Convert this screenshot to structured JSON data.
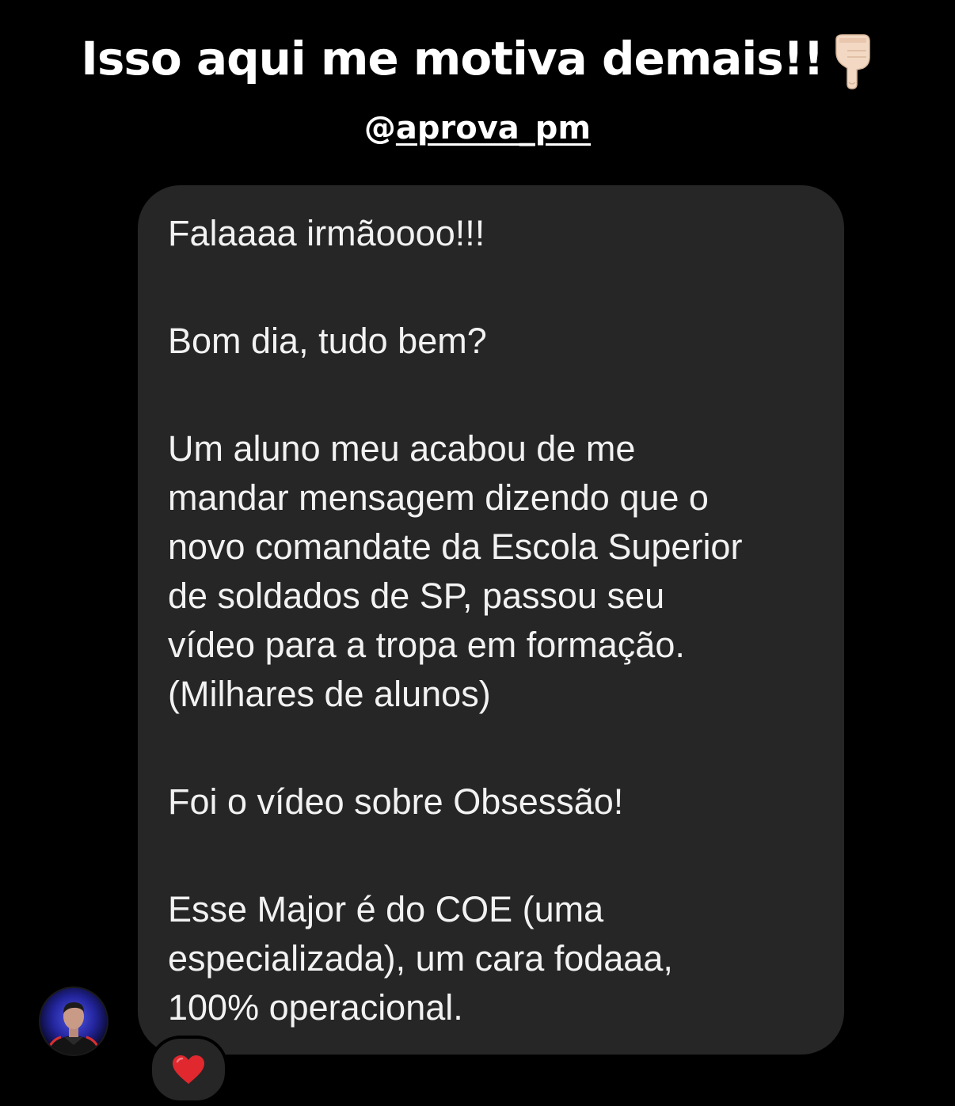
{
  "story": {
    "headline": "Isso aqui me motiva demais!!",
    "headline_emoji": "pointing-down-emoji",
    "mention_prefix": "@",
    "mention_handle": "aprova_pm"
  },
  "message": {
    "paragraphs": [
      "Falaaaa irmãoooo!!!",
      "Bom dia, tudo bem?",
      "Um aluno meu acabou de me\nmandar mensagem dizendo que o\nnovo comandate da Escola Superior\nde soldados de SP, passou seu\nvídeo para a tropa em formação.\n(Milhares de alunos)",
      "Foi o vídeo sobre Obsessão!",
      "Esse Major é do COE (uma\nespecializada), um cara fodaaa,\n100% operacional."
    ],
    "reaction": "red-heart-icon",
    "bubble_color": "#262626"
  },
  "colors": {
    "background": "#000000",
    "text": "#ffffff",
    "heart": "#e0282e",
    "avatar_accent": "#3c44c8"
  }
}
